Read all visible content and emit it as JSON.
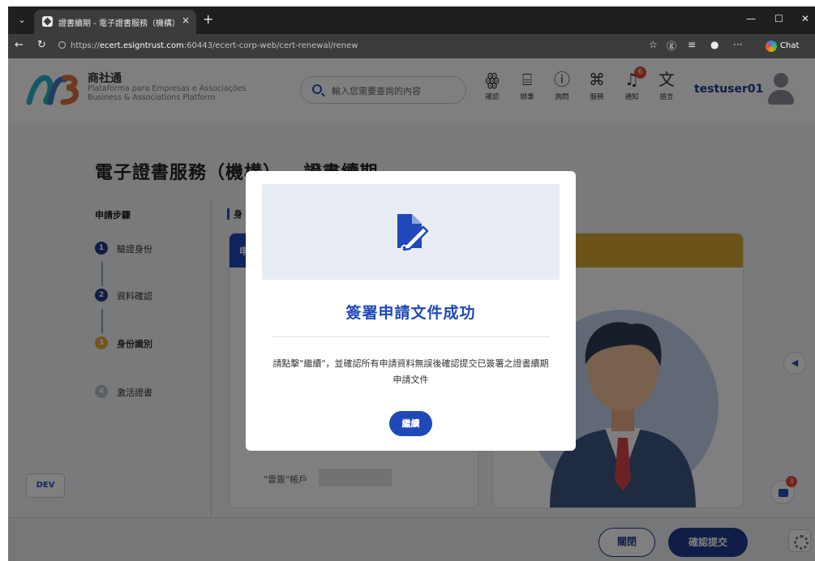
{
  "browser": {
    "tab_title": "證書續期 - 電子證書服務（機構）",
    "tab_close": "×",
    "new_tab": "+",
    "url_prefix": "https://",
    "url_host": "ecert.esigntrust.com",
    "url_path": ":60443/ecert-corp-web/cert-renewal/renew",
    "chat_label": "Chat"
  },
  "header": {
    "brand_name": "商社通",
    "brand_sub_pt": "Plataforma para Empresas e Associações",
    "brand_sub_en": "Business & Associations Platform",
    "search_placeholder": "輸入您需要查詢的內容",
    "nav": [
      {
        "label": "確認",
        "icon": "fingerprint-icon"
      },
      {
        "label": "辦事",
        "icon": "briefcase-icon"
      },
      {
        "label": "詢問",
        "icon": "question-icon"
      },
      {
        "label": "服務",
        "icon": "grid-icon"
      },
      {
        "label": "通知",
        "icon": "bell-icon",
        "badge": "6"
      },
      {
        "label": "語言",
        "icon": "translate-icon"
      }
    ],
    "username": "testuser01"
  },
  "main": {
    "page_title": "電子證書服務（機構） - 證書續期",
    "steps_heading": "申請步驟",
    "steps": [
      {
        "num": "1",
        "label": "驗證身份",
        "state": "done"
      },
      {
        "num": "2",
        "label": "資料確認",
        "state": "done"
      },
      {
        "num": "3",
        "label": "身份識別",
        "state": "current"
      },
      {
        "num": "4",
        "label": "激活證書",
        "state": "pending"
      }
    ],
    "section_title": "身",
    "card_head_label": "申",
    "cloud_account_label": "\"雲簽\"帳戶"
  },
  "dev_label": "DEV",
  "side_tab_glyph": "◀",
  "float_badge": "3",
  "footer": {
    "close_label": "關閉",
    "submit_label": "確認提交"
  },
  "modal": {
    "title": "簽署申請文件成功",
    "message": "請點擊\"繼續\"，並確認所有申請資料無誤後確認提交已簽署之證書續期申請文件",
    "continue_label": "繼續"
  },
  "colors": {
    "primary": "#1f49b8",
    "navy": "#1f3a8f",
    "gold": "#d9a634",
    "step_current": "#e8a93a",
    "badge_red": "#e04a3a"
  }
}
